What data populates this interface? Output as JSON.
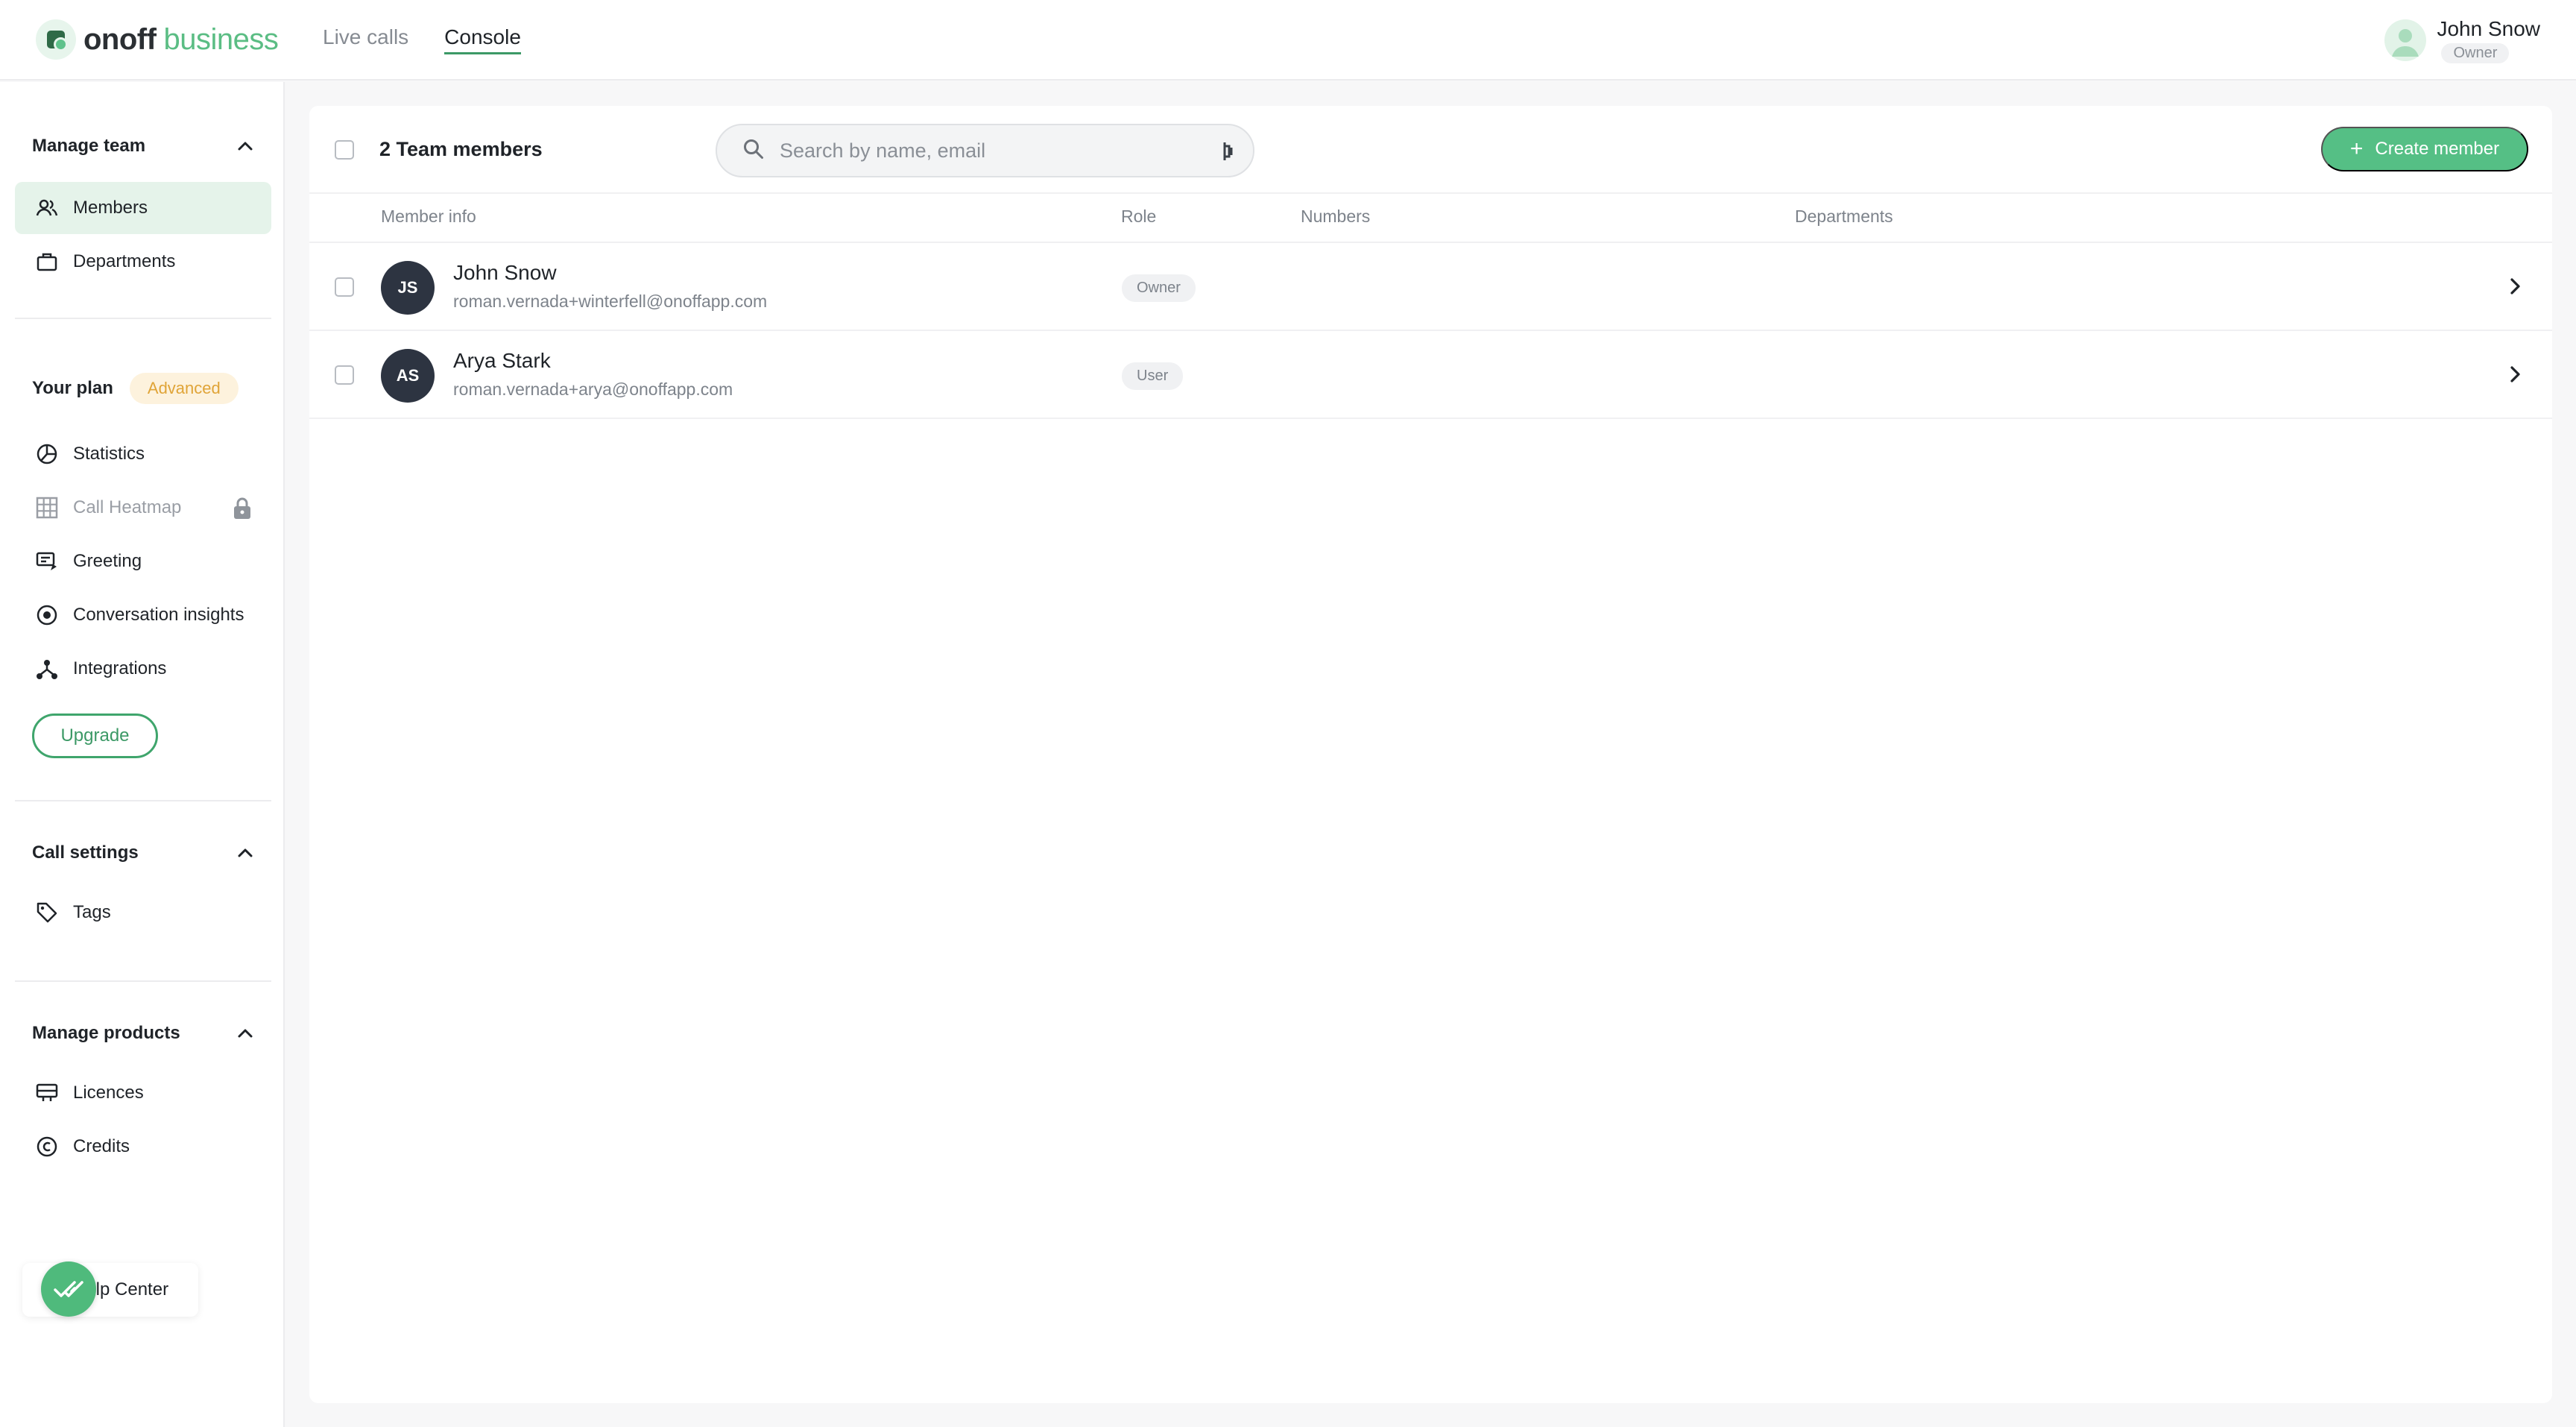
{
  "brand": {
    "name": "onoff",
    "sub": "business"
  },
  "topnav": {
    "live_calls": "Live calls",
    "console": "Console"
  },
  "user": {
    "name": "John Snow",
    "role": "Owner"
  },
  "sidebar": {
    "manage_team": {
      "title": "Manage team",
      "items": [
        {
          "label": "Members",
          "icon": "members-icon"
        },
        {
          "label": "Departments",
          "icon": "briefcase-icon"
        }
      ]
    },
    "plan": {
      "title": "Your plan",
      "badge": "Advanced",
      "items": [
        {
          "label": "Statistics",
          "icon": "pie-chart-icon"
        },
        {
          "label": "Call Heatmap",
          "icon": "grid-icon",
          "locked": true
        },
        {
          "label": "Greeting",
          "icon": "greeting-icon"
        },
        {
          "label": "Conversation insights",
          "icon": "target-icon"
        },
        {
          "label": "Integrations",
          "icon": "integrations-icon"
        }
      ],
      "upgrade": "Upgrade"
    },
    "call_settings": {
      "title": "Call settings",
      "items": [
        {
          "label": "Tags",
          "icon": "tag-icon"
        }
      ]
    },
    "manage_products": {
      "title": "Manage products",
      "items": [
        {
          "label": "Licences",
          "icon": "licence-icon"
        },
        {
          "label": "Credits",
          "icon": "credits-icon"
        }
      ]
    },
    "help": "Help Center"
  },
  "toolbar": {
    "team_count": "2 Team members",
    "search_placeholder": "Search by name, email",
    "create_button": "Create member"
  },
  "table": {
    "columns": [
      "Member info",
      "Role",
      "Numbers",
      "Departments"
    ],
    "rows": [
      {
        "initials": "JS",
        "name": "John Snow",
        "email": "roman.vernada+winterfell@onoffapp.com",
        "role": "Owner",
        "numbers": "",
        "departments": ""
      },
      {
        "initials": "AS",
        "name": "Arya Stark",
        "email": "roman.vernada+arya@onoffapp.com",
        "role": "User",
        "numbers": "",
        "departments": ""
      }
    ]
  },
  "colors": {
    "accent": "#55bf85",
    "accent_dark": "#3c9966",
    "plan_badge": "#e0a437",
    "avatar_bg": "#2d3441"
  }
}
